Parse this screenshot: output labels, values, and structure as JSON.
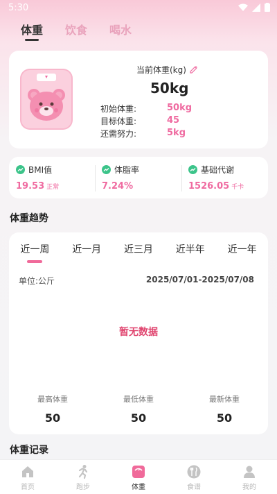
{
  "status": {
    "time": "5:30"
  },
  "tabs": [
    {
      "label": "体重"
    },
    {
      "label": "饮食"
    },
    {
      "label": "喝水"
    }
  ],
  "weight_card": {
    "current_label": "当前体重(kg)",
    "current_value": "50kg",
    "rows": [
      {
        "label": "初始体重:",
        "value": "50kg"
      },
      {
        "label": "目标体重:",
        "value": "45"
      },
      {
        "label": "还需努力:",
        "value": "5kg"
      }
    ]
  },
  "stats": [
    {
      "label": "BMI值",
      "value": "19.53",
      "unit": "正常"
    },
    {
      "label": "体脂率",
      "value": "7.24%",
      "unit": ""
    },
    {
      "label": "基础代谢",
      "value": "1526.05",
      "unit": "千卡"
    }
  ],
  "trend": {
    "title": "体重趋势",
    "ranges": [
      "近一周",
      "近一月",
      "近三月",
      "近半年",
      "近一年"
    ],
    "unit_label": "单位:公斤",
    "date_range": "2025/07/01-2025/07/08",
    "empty_text": "暂无数据",
    "summary": [
      {
        "label": "最高体重",
        "value": "50"
      },
      {
        "label": "最低体重",
        "value": "50"
      },
      {
        "label": "最新体重",
        "value": "50"
      }
    ]
  },
  "records": {
    "title": "体重记录"
  },
  "nav": [
    {
      "label": "首页",
      "icon": "home-icon"
    },
    {
      "label": "跑步",
      "icon": "run-icon"
    },
    {
      "label": "体重",
      "icon": "scale-icon"
    },
    {
      "label": "食谱",
      "icon": "utensils-icon"
    },
    {
      "label": "我的",
      "icon": "person-icon"
    }
  ],
  "colors": {
    "accent": "#ef6aa0",
    "green": "#3cc48a",
    "empty": "#e0456f"
  }
}
